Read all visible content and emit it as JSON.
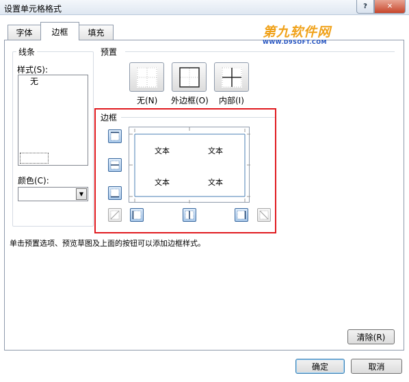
{
  "window": {
    "title": "设置单元格格式",
    "help_label": "?",
    "close_label": "✕"
  },
  "tabs": [
    {
      "label": "字体",
      "active": false
    },
    {
      "label": "边框",
      "active": true
    },
    {
      "label": "填充",
      "active": false
    }
  ],
  "watermark": {
    "main": "第九软件网",
    "sub": "WWW.D9SOFT.COM"
  },
  "line": {
    "section_label": "线条",
    "style_label": "样式(S):",
    "style_none": "无",
    "color_label": "颜色(C):",
    "color_value": ""
  },
  "presets": {
    "section_label": "预置",
    "items": [
      {
        "label": "无(N)",
        "icon": "no-border-icon"
      },
      {
        "label": "外边框(O)",
        "icon": "outline-border-icon"
      },
      {
        "label": "内部(I)",
        "icon": "inside-border-icon"
      }
    ]
  },
  "border": {
    "section_label": "边框",
    "highlight_color": "#e0191e",
    "preview_texts": [
      "文本",
      "文本",
      "文本",
      "文本"
    ],
    "buttons": [
      "border-top-icon",
      "border-middle-horizontal-icon",
      "border-bottom-icon",
      "border-diagonal-up-icon",
      "border-left-icon",
      "border-middle-vertical-icon",
      "border-right-icon",
      "border-diagonal-down-icon"
    ]
  },
  "hint": "单击预置选项、预览草图及上面的按钮可以添加边框样式。",
  "buttons": {
    "clear": "清除(R)",
    "ok": "确定",
    "cancel": "取消"
  },
  "colors": {
    "accent_blue": "#3c6a9f",
    "preview_line": "#4a7fb5",
    "watermark_orange": "#f0a21b",
    "watermark_blue": "#1f4fbf"
  }
}
